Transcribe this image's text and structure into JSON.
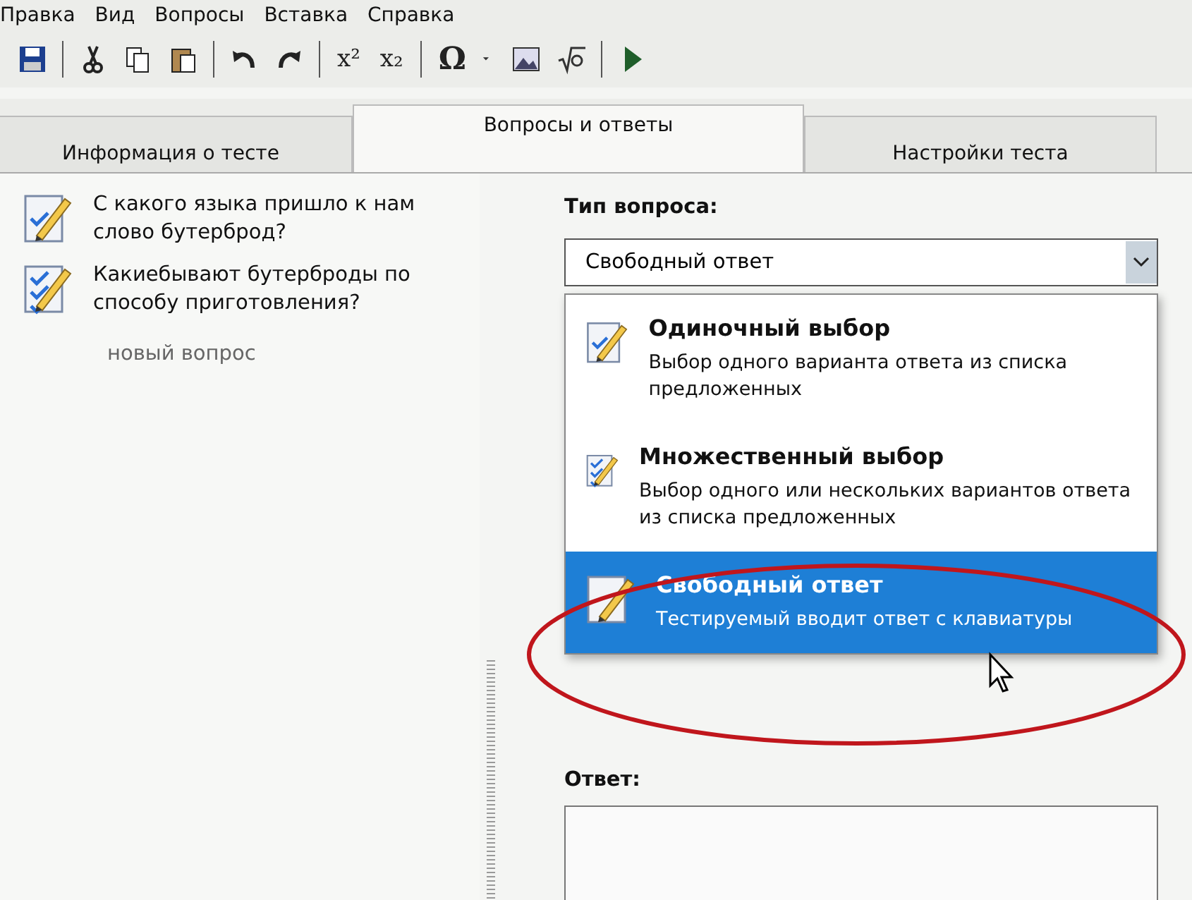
{
  "menu": [
    "Правка",
    "Вид",
    "Вопросы",
    "Вставка",
    "Справка"
  ],
  "toolbar": {
    "glyphs": [
      "x²",
      "x₂",
      "Ω"
    ]
  },
  "tabs": [
    {
      "label": "Информация о тесте",
      "selected": false
    },
    {
      "label": "Вопросы и ответы",
      "selected": true
    },
    {
      "label": "Настройки теста",
      "selected": false
    }
  ],
  "questions": [
    {
      "kind": "single",
      "text": "С какого языка пришло к нам слово бутерброд?"
    },
    {
      "kind": "multiple",
      "text": "Какиебывают  бутерброды по способу приготовления?"
    },
    {
      "kind": "new",
      "text": "новый вопрос"
    }
  ],
  "question_type": {
    "label": "Тип вопроса:",
    "value": "Свободный ответ",
    "expanded": true,
    "options": [
      {
        "kind": "single",
        "title": "Одиночный выбор",
        "description": "Выбор одного варианта ответа из списка предложенных",
        "selected": false
      },
      {
        "kind": "multiple",
        "title": "Множественный выбор",
        "description": "Выбор одного или нескольких вариантов ответа из списка предложенных",
        "selected": false
      },
      {
        "kind": "free",
        "title": "Свободный ответ",
        "description": "Тестируемый вводит ответ с клавиатуры",
        "selected": true
      }
    ]
  },
  "answer": {
    "label": "Ответ:"
  }
}
